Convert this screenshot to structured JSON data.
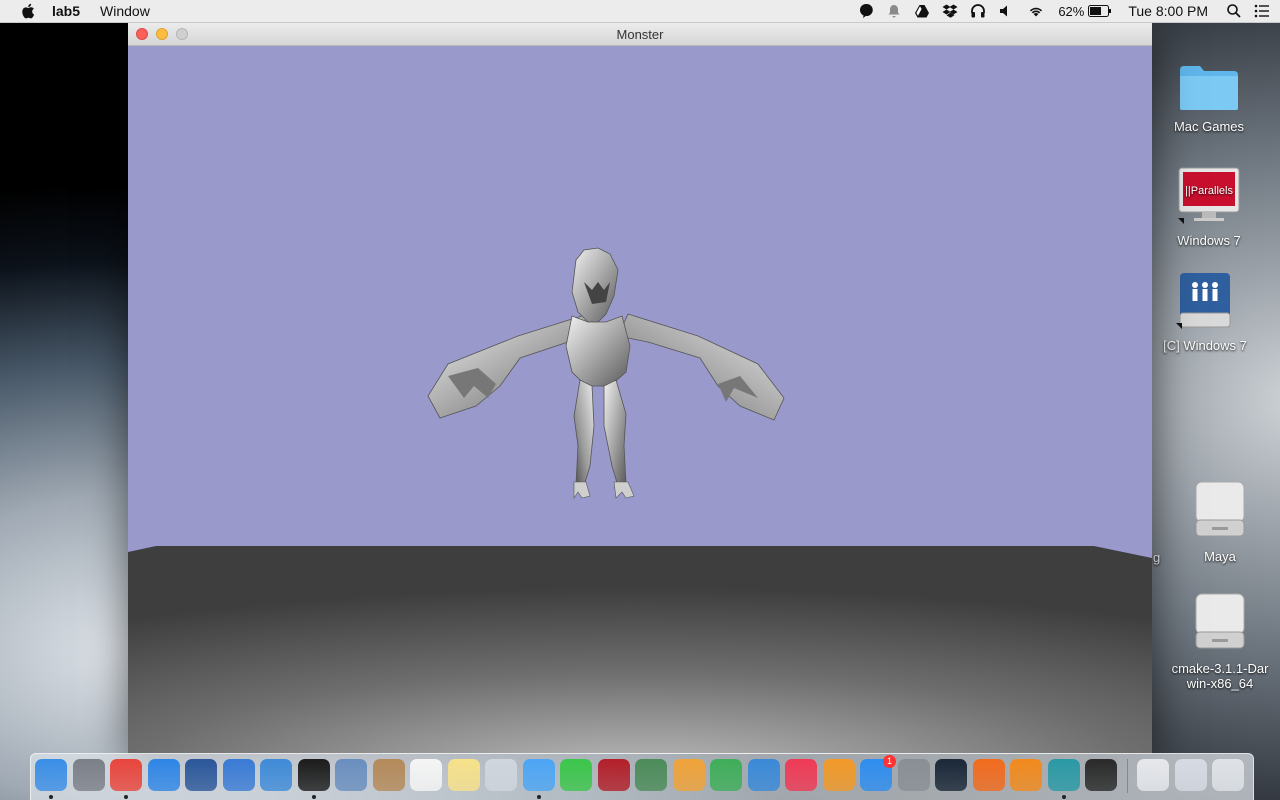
{
  "menubar": {
    "app_name": "lab5",
    "menus": [
      "Window"
    ],
    "battery_percent": "62%",
    "clock": "Tue 8:00 PM",
    "status_icons": [
      "notification-icon",
      "bell-icon",
      "google-drive-icon",
      "dropbox-icon",
      "headphones-icon",
      "volume-icon",
      "wifi-icon",
      "battery-icon",
      "spotlight-search-icon",
      "notification-center-icon"
    ]
  },
  "window": {
    "title": "Monster",
    "scene": {
      "sky_color": "#9999cc",
      "model": "winged-monster-model"
    }
  },
  "desktop_icons": [
    {
      "label": "Mac Games",
      "icon": "folder-icon"
    },
    {
      "label": "Windows 7",
      "icon": "parallels-icon"
    },
    {
      "label": "[C] Windows 7",
      "icon": "network-drive-icon"
    },
    {
      "label": "Maya",
      "icon": "disk-image-icon"
    },
    {
      "label": "cmake-3.1.1-Darwin-x86_64",
      "icon": "disk-image-icon"
    }
  ],
  "desktop_partial_label": "g",
  "dock": {
    "apps": [
      {
        "name": "finder-icon",
        "color": "#3a8ee6",
        "running": true
      },
      {
        "name": "launchpad-icon",
        "color": "#7a7f88",
        "running": false
      },
      {
        "name": "chrome-icon",
        "color": "#e8453c",
        "running": true
      },
      {
        "name": "safari-icon",
        "color": "#2f86e6",
        "running": false
      },
      {
        "name": "word-icon",
        "color": "#2b579a",
        "running": false
      },
      {
        "name": "unity-icon",
        "color": "#3a7bd5",
        "running": false
      },
      {
        "name": "xcode-icon",
        "color": "#3f8bd8",
        "running": false
      },
      {
        "name": "terminal-icon",
        "color": "#1c1c1c",
        "running": true
      },
      {
        "name": "preview-icon",
        "color": "#6a8fbf",
        "running": false
      },
      {
        "name": "contacts-icon",
        "color": "#b48a5a",
        "running": false
      },
      {
        "name": "calendar-icon",
        "color": "#f5f5f5",
        "running": false
      },
      {
        "name": "notes-icon",
        "color": "#f7e28a",
        "running": false
      },
      {
        "name": "preview-photos-icon",
        "color": "#cfd6de",
        "running": false
      },
      {
        "name": "messages-icon",
        "color": "#4da6f5",
        "running": true
      },
      {
        "name": "facetime-icon",
        "color": "#3cc64b",
        "running": false
      },
      {
        "name": "photo-booth-icon",
        "color": "#b3202a",
        "running": false
      },
      {
        "name": "iphoto-icon",
        "color": "#4c8c5a",
        "running": false
      },
      {
        "name": "pages-icon",
        "color": "#f0a33a",
        "running": false
      },
      {
        "name": "numbers-icon",
        "color": "#3fae5a",
        "running": false
      },
      {
        "name": "keynote-icon",
        "color": "#3a8ad8",
        "running": false
      },
      {
        "name": "itunes-icon",
        "color": "#f03a55",
        "running": false
      },
      {
        "name": "ibooks-icon",
        "color": "#f29a28",
        "running": false
      },
      {
        "name": "app-store-icon",
        "color": "#2f8ef0",
        "running": false,
        "badge": "1"
      },
      {
        "name": "system-preferences-icon",
        "color": "#8a8f96",
        "running": false
      },
      {
        "name": "steam-icon",
        "color": "#1b2838",
        "running": false
      },
      {
        "name": "origin-icon",
        "color": "#f26b1d",
        "running": false
      },
      {
        "name": "headphones-app-icon",
        "color": "#f28a1d",
        "running": false
      },
      {
        "name": "maya-icon",
        "color": "#2a9aa5",
        "running": true
      },
      {
        "name": "console-icon",
        "color": "#2a2a2a",
        "running": false
      }
    ],
    "right": [
      {
        "name": "zip-archive-icon",
        "color": "#e6e8ec"
      },
      {
        "name": "downloads-stack-icon",
        "color": "#d6dbe3"
      },
      {
        "name": "trash-icon",
        "color": "#dfe3e8"
      }
    ]
  }
}
